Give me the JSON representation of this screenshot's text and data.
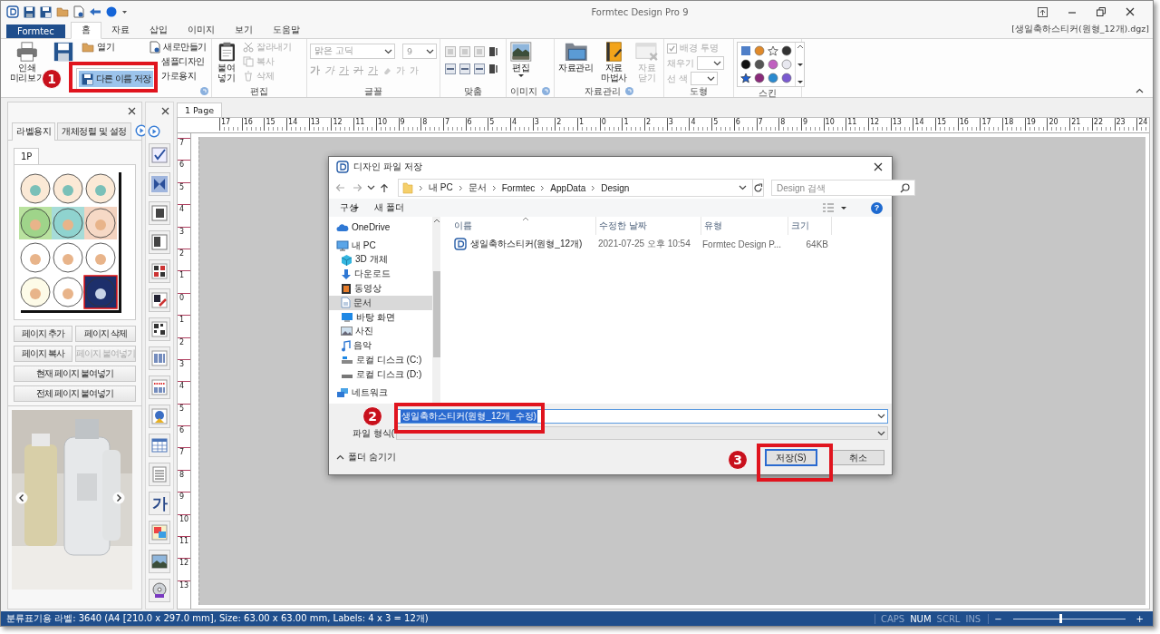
{
  "window": {
    "title": "Formtec Design Pro 9",
    "document": "[생일축하스티커(원형_12개).dgz]"
  },
  "ribbon_tabs": [
    {
      "label": "Formtec",
      "kind": "file",
      "selected": false
    },
    {
      "label": "홈",
      "kind": "tab",
      "selected": true
    },
    {
      "label": "자료",
      "kind": "tab",
      "selected": false
    },
    {
      "label": "삽입",
      "kind": "tab",
      "selected": false
    },
    {
      "label": "이미지",
      "kind": "tab",
      "selected": false
    },
    {
      "label": "보기",
      "kind": "tab",
      "selected": false
    },
    {
      "label": "도움말",
      "kind": "tab",
      "selected": false
    }
  ],
  "file_group": {
    "large": [
      "인쇄 미리보기"
    ],
    "open": "열기",
    "right": [
      "새로만들기",
      "샘플디자인",
      "가로용지"
    ],
    "menu_item": {
      "label": "다른 이름 저장",
      "selected": true
    }
  },
  "edit_group": {
    "title": "편집",
    "paste": "붙여넣기",
    "actions": [
      {
        "label": "잘라내기",
        "disabled": true
      },
      {
        "label": "복사",
        "disabled": true
      },
      {
        "label": "삭제",
        "disabled": true
      }
    ]
  },
  "font_group": {
    "title": "글꼴",
    "font": "맑은 고딕",
    "size": "9",
    "styles": [
      "가",
      "가",
      "가",
      "가",
      "가",
      "가",
      "가"
    ]
  },
  "align_group": {
    "title": "맞춤"
  },
  "image_group": {
    "title": "이미지",
    "edit": "편집"
  },
  "data_group": {
    "title": "자료관리",
    "buttons": [
      {
        "label": "자료관리",
        "disabled": false
      },
      {
        "label": "자료 마법사",
        "disabled": false
      },
      {
        "label": "자료 닫기",
        "disabled": true
      }
    ]
  },
  "shape_group": {
    "title": "도형",
    "transparent": {
      "label": "배경 투명",
      "checked": true
    },
    "fill": "채우기",
    "line": "선 색"
  },
  "skin_group": {
    "title": "스킨"
  },
  "left_panel": {
    "tabs": [
      {
        "label": "라벨용지",
        "selected": true
      },
      {
        "label": "개체정렬 및 설정",
        "selected": false
      }
    ],
    "page_tab": "1P",
    "buttons": [
      {
        "label": "페이지 추가",
        "disabled": false
      },
      {
        "label": "페이지 삭제",
        "disabled": false
      },
      {
        "label": "페이지 복사",
        "disabled": false
      },
      {
        "label": "페이지 붙여넣기",
        "disabled": true
      },
      {
        "label": "현재 페이지 붙여넣기",
        "disabled": false
      },
      {
        "label": "전체 페이지 붙여넣기",
        "disabled": false
      }
    ]
  },
  "toolbox": {
    "text_tool": "가"
  },
  "document_tabs": [
    {
      "label": "1 Page",
      "selected": true
    }
  ],
  "rulers": {
    "horizontal": [
      "17",
      "16",
      "15",
      "14",
      "13",
      "12",
      "11",
      "10",
      "9",
      "8",
      "7",
      "6",
      "5",
      "4",
      "3",
      "2",
      "1",
      "0",
      "1",
      "2",
      "3",
      "4",
      "5",
      "6",
      "7",
      "8",
      "9",
      "10",
      "11",
      "12",
      "13",
      "14",
      "15",
      "16",
      "17",
      "18",
      "19",
      "20",
      "21",
      "22",
      "23",
      "24"
    ],
    "vertical": [
      "7",
      "6",
      "5",
      "4",
      "3",
      "2",
      "1",
      "0",
      "1",
      "2",
      "3",
      "4",
      "5",
      "6",
      "7",
      "8",
      "9",
      "10",
      "11",
      "12",
      "13"
    ]
  },
  "dialog": {
    "title": "디자인 파일 저장",
    "path": [
      "내 PC",
      "문서",
      "Formtec",
      "AppData",
      "Design"
    ],
    "search_placeholder": "Design 검색",
    "toolbar": [
      "구성",
      "새 폴더"
    ],
    "help": "?",
    "nav": [
      {
        "label": "OneDrive",
        "selected": false
      },
      {
        "label": "내 PC",
        "selected": false,
        "children": [
          {
            "label": "3D 개체",
            "selected": false
          },
          {
            "label": "다운로드",
            "selected": false
          },
          {
            "label": "동영상",
            "selected": false
          },
          {
            "label": "문서",
            "selected": true
          },
          {
            "label": "바탕 화면",
            "selected": false
          },
          {
            "label": "사진",
            "selected": false
          },
          {
            "label": "음악",
            "selected": false
          },
          {
            "label": "로컬 디스크 (C:)",
            "selected": false
          },
          {
            "label": "로컬 디스크 (D:)",
            "selected": false
          }
        ]
      },
      {
        "label": "네트워크",
        "selected": false
      }
    ],
    "columns": [
      "이름",
      "수정한 날짜",
      "유형",
      "크기"
    ],
    "files": [
      {
        "name": "생일축하스티커(원형_12개)",
        "modified": "2021-07-25 오후 10:54",
        "type": "Formtec Design P...",
        "size": "64KB"
      }
    ],
    "file_name": "생일축하스티커(원형_12개_수정)",
    "file_type_label": "파일 형식(",
    "hide_folders": "폴더 숨기기",
    "buttons": [
      {
        "label": "저장(S)",
        "kind": "default"
      },
      {
        "label": "취소",
        "kind": "normal"
      }
    ]
  },
  "annotations": [
    {
      "label": "1"
    },
    {
      "label": "2"
    },
    {
      "label": "3"
    }
  ],
  "status_bar": {
    "text": "분류표기용 라벨: 3640 (A4 [210.0 x 297.0 mm], Size: 63.00 x 63.00 mm,  Labels: 4 x 3 = 12개)",
    "indicators": [
      {
        "label": "CAPS",
        "on": false
      },
      {
        "label": "NUM",
        "on": true
      },
      {
        "label": "SCRL",
        "on": false
      },
      {
        "label": "INS",
        "on": false
      }
    ],
    "zoom": {
      "minus": "−",
      "plus": "+",
      "level": 0.42
    }
  }
}
